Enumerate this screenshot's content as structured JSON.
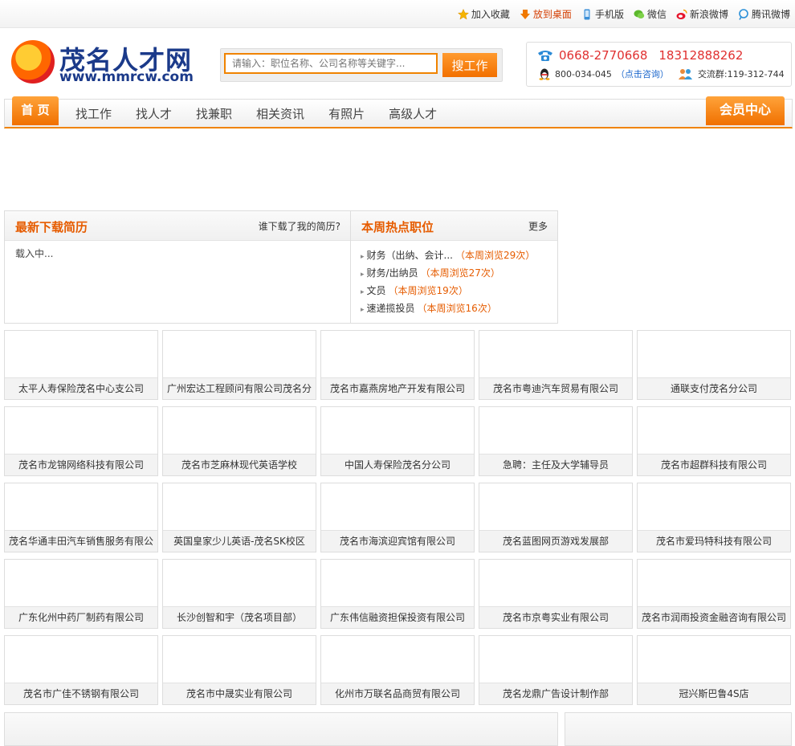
{
  "topbar": {
    "links": [
      {
        "label": "加入收藏",
        "icon": "star-icon"
      },
      {
        "label": "放到桌面",
        "icon": "download-arrow-icon"
      },
      {
        "label": "手机版",
        "icon": "mobile-icon"
      },
      {
        "label": "微信",
        "icon": "wechat-icon"
      },
      {
        "label": "新浪微博",
        "icon": "weibo-icon"
      },
      {
        "label": "腾讯微博",
        "icon": "tencent-weibo-icon"
      }
    ]
  },
  "logo": {
    "cn": "茂名人才网",
    "url": "www.mmrcw.com"
  },
  "search": {
    "placeholder": "请输入：职位名称、公司名称等关键字...",
    "button": "搜工作"
  },
  "contact": {
    "phone1": "0668-2770668",
    "phone2": "18312888262",
    "qq": "800-034-045",
    "consult": "（点击咨询）",
    "group": "交流群:119-312-744"
  },
  "nav": {
    "home": "首 页",
    "items": [
      "找工作",
      "找人才",
      "找兼职",
      "相关资讯",
      "有照片",
      "高级人才"
    ],
    "member": "会员中心"
  },
  "resume_panel": {
    "title": "最新下载简历",
    "link": "谁下载了我的简历?",
    "loading": "载入中..."
  },
  "hot_panel": {
    "title": "本周热点职位",
    "link": "更多",
    "items": [
      {
        "job": "财务（出纳、会计...",
        "views": "（本周浏览29次）"
      },
      {
        "job": "财务/出纳员",
        "views": "（本周浏览27次）"
      },
      {
        "job": "文员",
        "views": "（本周浏览19次）"
      },
      {
        "job": "速递揽投员",
        "views": "（本周浏览16次）"
      }
    ]
  },
  "companies": [
    "太平人寿保险茂名中心支公司",
    "广州宏达工程顾问有限公司茂名分",
    "茂名市嘉燕房地产开发有限公司",
    "茂名市粤迪汽车贸易有限公司",
    "通联支付茂名分公司",
    "茂名市龙锦网络科技有限公司",
    "茂名市芝麻林现代英语学校",
    "中国人寿保险茂名分公司",
    "急聘：主任及大学辅导员",
    "茂名市超群科技有限公司",
    "茂名华通丰田汽车销售服务有限公",
    "英国皇家少儿英语-茂名SK校区",
    "茂名市海滨迎宾馆有限公司",
    "茂名蓝图网页游戏发展部",
    "茂名市爱玛特科技有限公司",
    "广东化州中药厂制药有限公司",
    "长沙创智和宇（茂名项目部）",
    "广东伟信融资担保投资有限公司",
    "茂名市京粤实业有限公司",
    "茂名市润雨投资金融咨询有限公司",
    "茂名市广佳不锈钢有限公司",
    "茂名市中晟实业有限公司",
    "化州市万联名品商贸有限公司",
    "茂名龙鼎广告设计制作部",
    "冠兴斯巴鲁4S店"
  ]
}
